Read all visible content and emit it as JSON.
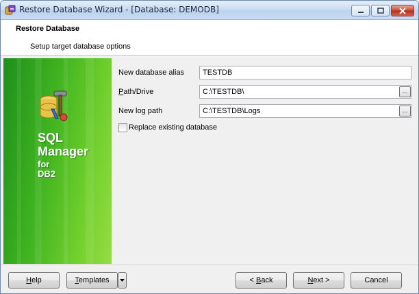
{
  "window": {
    "title": "Restore Database Wizard - [Database: DEMODB]"
  },
  "header": {
    "title": "Restore Database",
    "subtitle": "Setup target database options"
  },
  "brand": {
    "line1": "SQL",
    "line2": "Manager",
    "line3": "for",
    "line4": "DB2"
  },
  "form": {
    "alias_label": "New database alias",
    "alias_value": "TESTDB",
    "path_label_hotkey": "P",
    "path_label_rest": "ath/Drive",
    "path_value": "C:\\TESTDB\\",
    "log_label": "New log path",
    "log_value": "C:\\TESTDB\\Logs",
    "browse_label": "...",
    "replace_label": "Replace existing database",
    "replace_checked": false
  },
  "footer": {
    "help_hotkey": "H",
    "help_rest": "elp",
    "templates_hotkey": "T",
    "templates_rest": "emplates",
    "back_prefix": "< ",
    "back_hotkey": "B",
    "back_rest": "ack",
    "next_hotkey": "N",
    "next_rest": "ext >",
    "cancel_label": "Cancel"
  },
  "icons": {
    "app": "database-wizard-icon",
    "logo": "database-tools-icon",
    "dropdown": "triangle-down-icon"
  },
  "colors": {
    "panel_green": "#3fb31f",
    "titlebar": "#c9dcf2"
  }
}
